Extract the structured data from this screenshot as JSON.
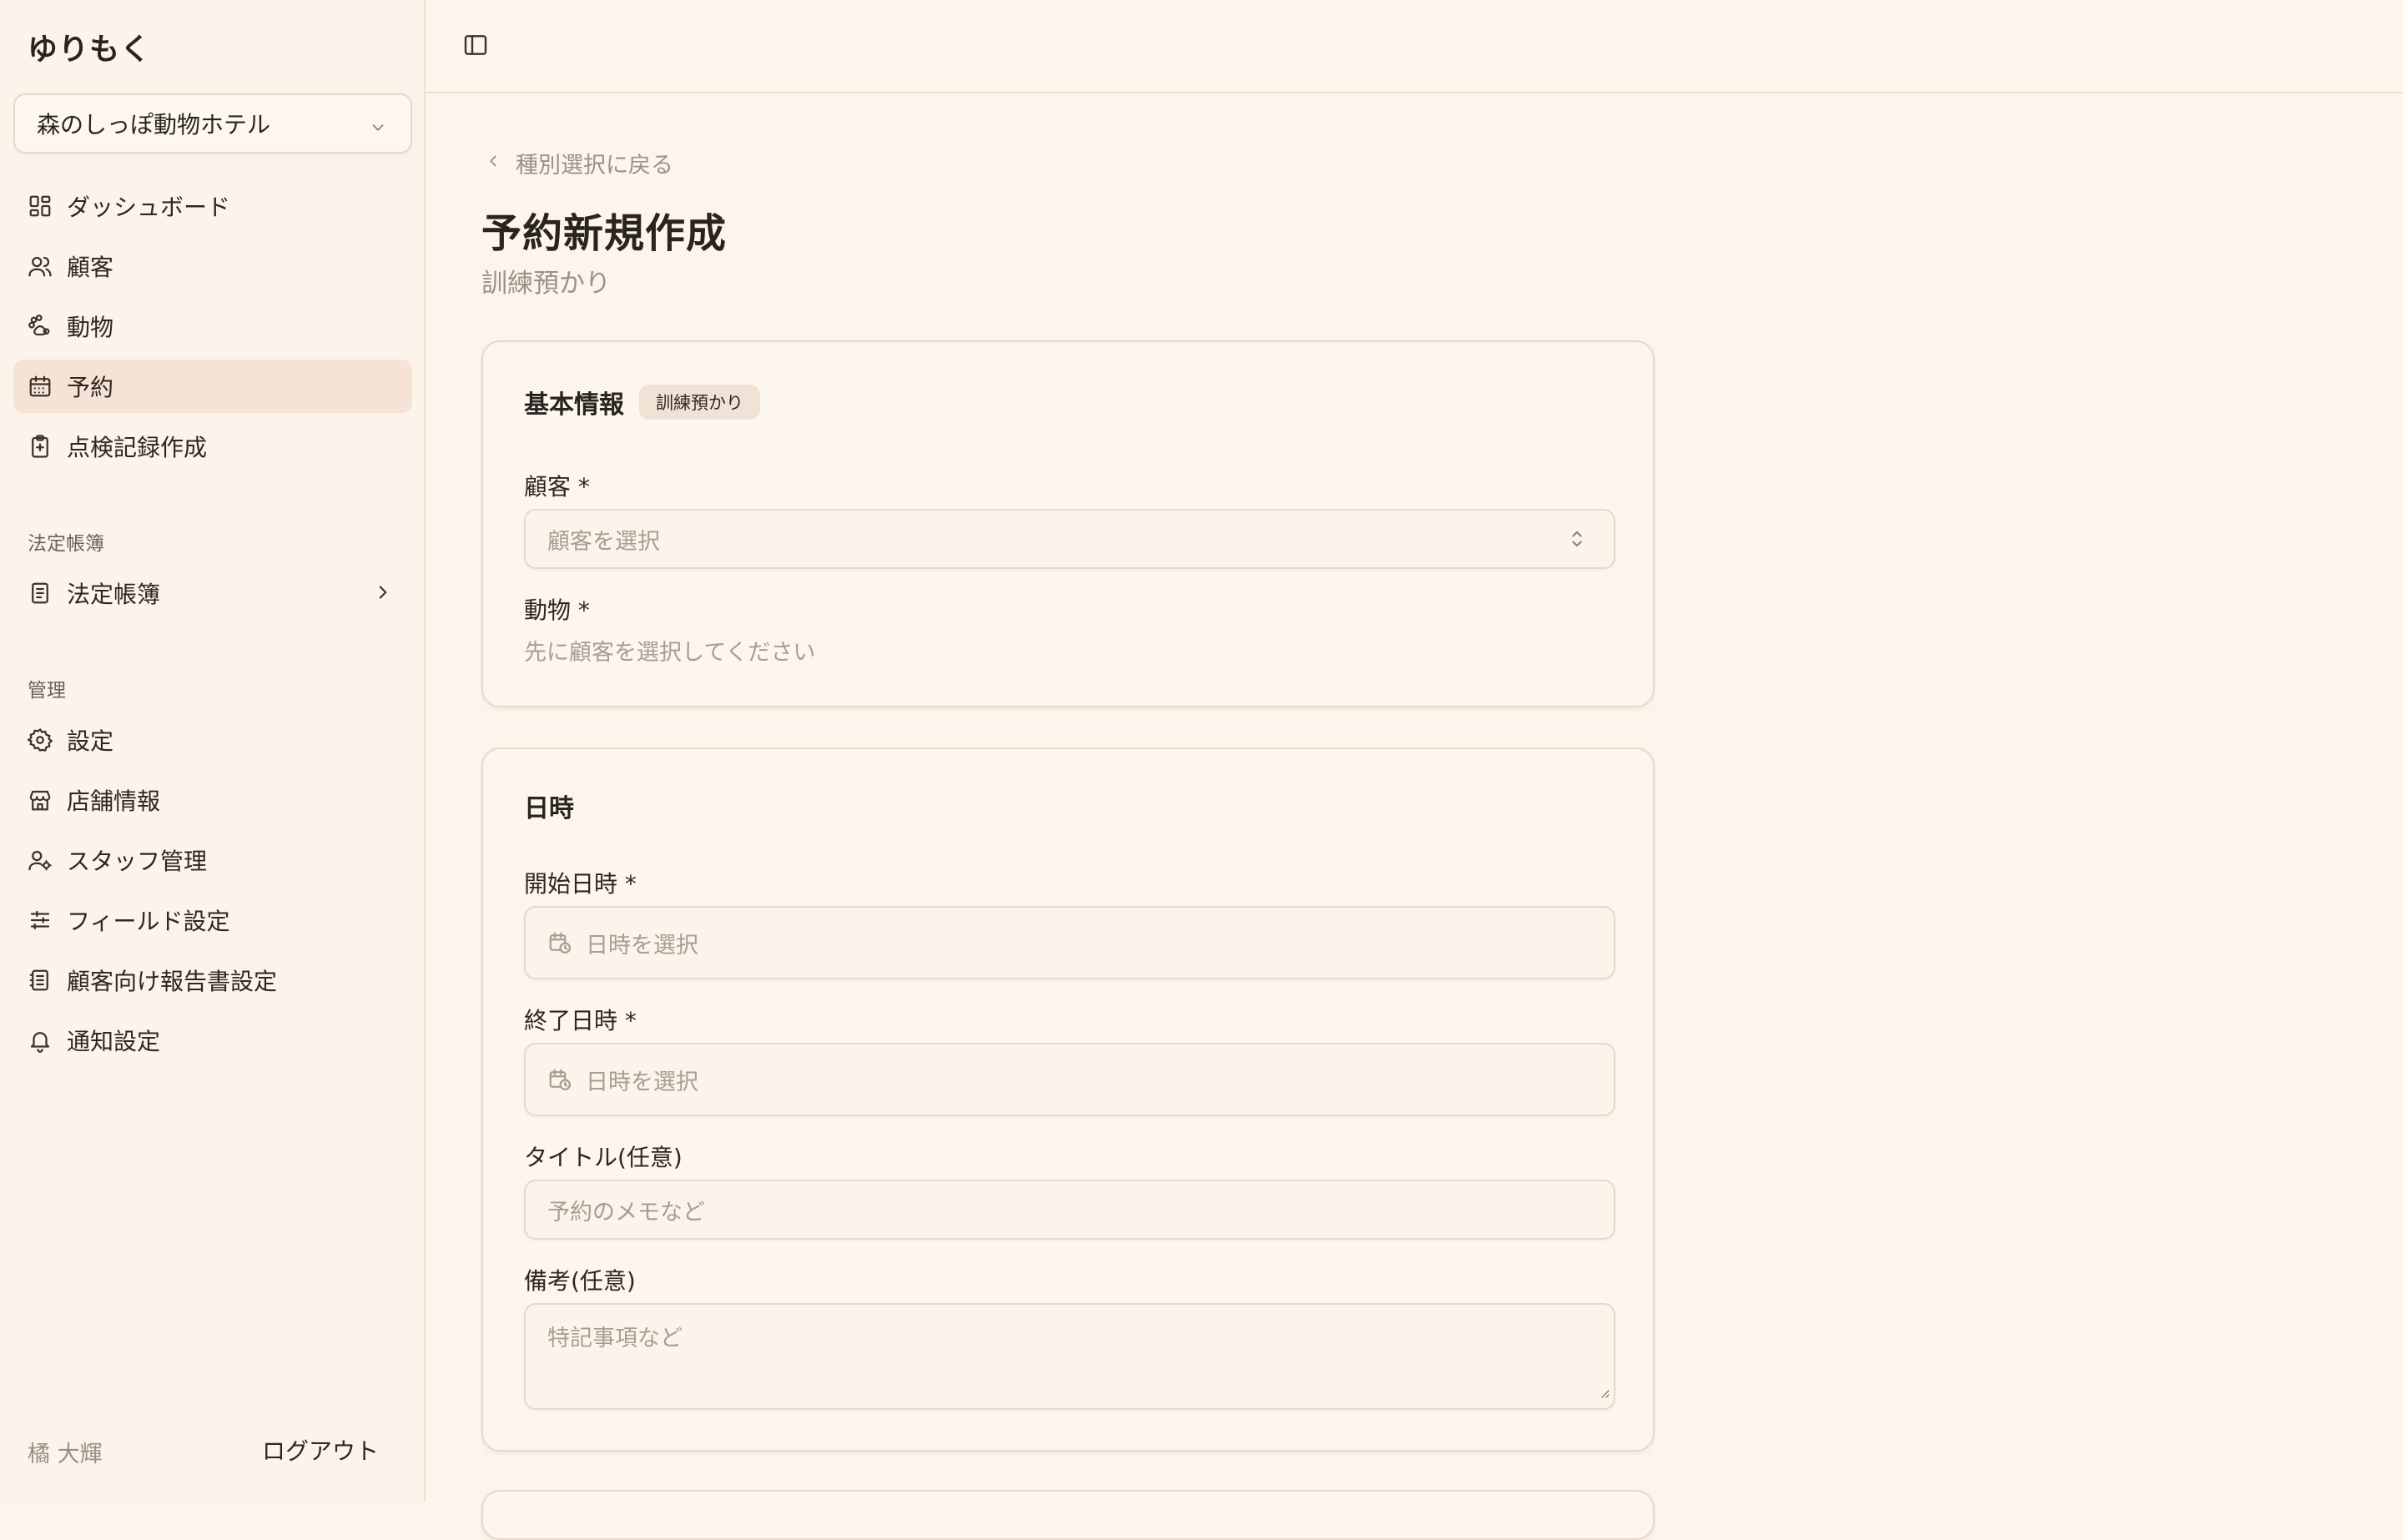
{
  "app": {
    "brand": "ゆりもく",
    "store": "森のしっぽ動物ホテル"
  },
  "sidebar": {
    "main_items": [
      {
        "label": "ダッシュボード",
        "icon": "dashboard-icon"
      },
      {
        "label": "顧客",
        "icon": "users-icon"
      },
      {
        "label": "動物",
        "icon": "paw-icon"
      },
      {
        "label": "予約",
        "icon": "calendar-icon",
        "active": true
      },
      {
        "label": "点検記録作成",
        "icon": "clipboard-plus-icon"
      }
    ],
    "legal_section_label": "法定帳簿",
    "legal_items": [
      {
        "label": "法定帳簿",
        "icon": "book-icon"
      }
    ],
    "admin_section_label": "管理",
    "admin_items": [
      {
        "label": "設定",
        "icon": "gear-icon"
      },
      {
        "label": "店舗情報",
        "icon": "store-icon"
      },
      {
        "label": "スタッフ管理",
        "icon": "user-cog-icon"
      },
      {
        "label": "フィールド設定",
        "icon": "sliders-icon"
      },
      {
        "label": "顧客向け報告書設定",
        "icon": "report-icon"
      },
      {
        "label": "通知設定",
        "icon": "bell-icon"
      }
    ],
    "user_name": "橘 大輝",
    "logout_label": "ログアウト"
  },
  "page": {
    "back_label": "種別選択に戻る",
    "title": "予約新規作成",
    "subtitle": "訓練預かり"
  },
  "basic_info": {
    "title": "基本情報",
    "badge": "訓練預かり",
    "customer_label": "顧客 *",
    "customer_placeholder": "顧客を選択",
    "animal_label": "動物 *",
    "animal_hint": "先に顧客を選択してください"
  },
  "datetime": {
    "title": "日時",
    "start_label": "開始日時 *",
    "start_placeholder": "日時を選択",
    "end_label": "終了日時 *",
    "end_placeholder": "日時を選択",
    "title_label": "タイトル(任意)",
    "title_placeholder": "予約のメモなど",
    "notes_label": "備考(任意)",
    "notes_placeholder": "特記事項など"
  },
  "colors": {
    "background": "#fdf5ec",
    "active_nav": "#f5e3d6",
    "border": "#e6d9cb"
  }
}
